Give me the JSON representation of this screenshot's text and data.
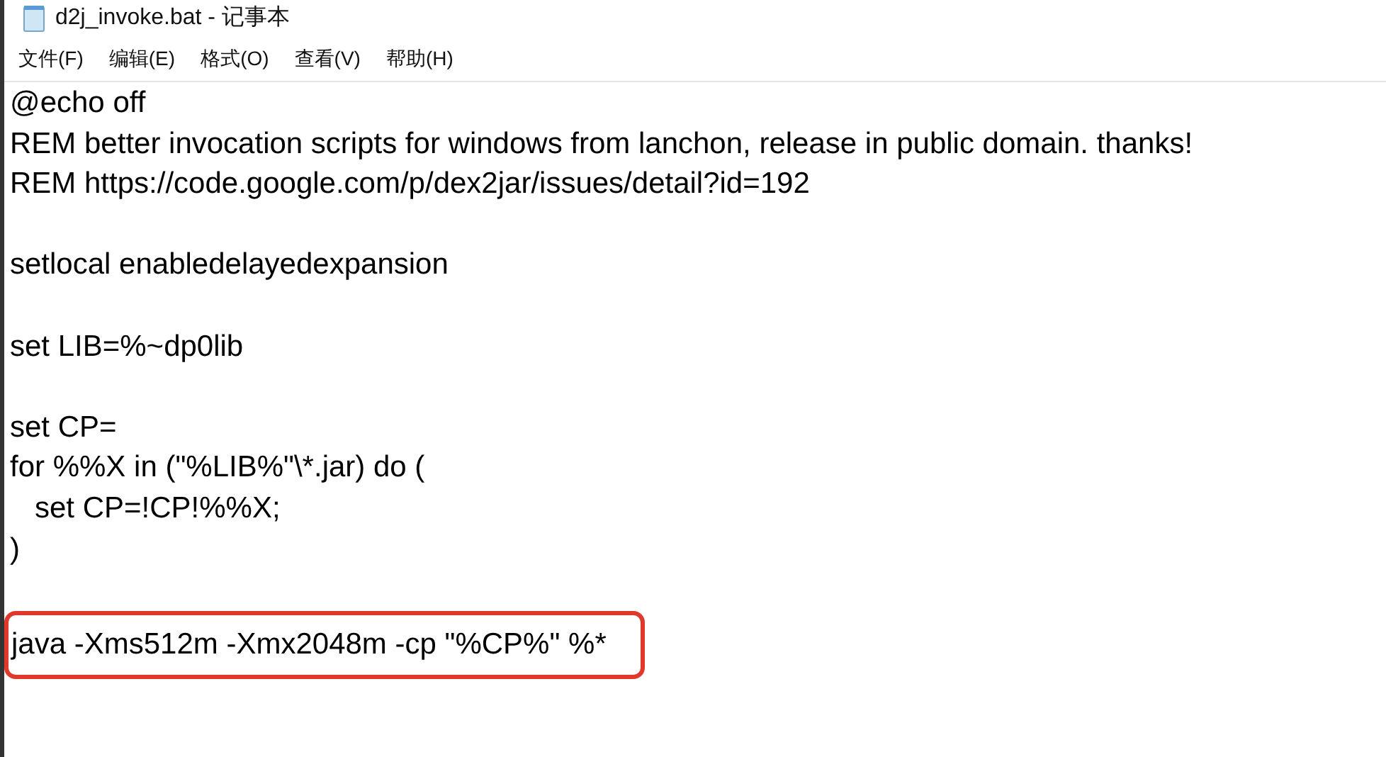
{
  "window": {
    "title": "d2j_invoke.bat - 记事本"
  },
  "menu": [
    {
      "label": "文件(F)"
    },
    {
      "label": "编辑(E)"
    },
    {
      "label": "格式(O)"
    },
    {
      "label": "查看(V)"
    },
    {
      "label": "帮助(H)"
    }
  ],
  "editor": {
    "blocks": [
      {
        "lines": [
          {
            "text": "@echo off",
            "highlighted": false
          },
          {
            "text": "REM better invocation scripts for windows from lanchon, release in public domain. thanks!",
            "highlighted": false
          },
          {
            "text": "REM https://code.google.com/p/dex2jar/issues/detail?id=192",
            "highlighted": false
          }
        ]
      },
      {
        "lines": [
          {
            "text": "setlocal enabledelayedexpansion",
            "highlighted": false
          }
        ]
      },
      {
        "lines": [
          {
            "text": "set LIB=%~dp0lib",
            "highlighted": false
          }
        ]
      },
      {
        "lines": [
          {
            "text": "set CP=",
            "highlighted": false
          },
          {
            "text": "for %%X in (\"%LIB%\"\\*.jar) do (",
            "highlighted": false
          },
          {
            "text": "   set CP=!CP!%%X;",
            "highlighted": false
          },
          {
            "text": ")",
            "highlighted": false
          }
        ]
      },
      {
        "lines": [
          {
            "text": "java -Xms512m -Xmx2048m -cp \"%CP%\" %*",
            "highlighted": true
          }
        ]
      }
    ]
  }
}
